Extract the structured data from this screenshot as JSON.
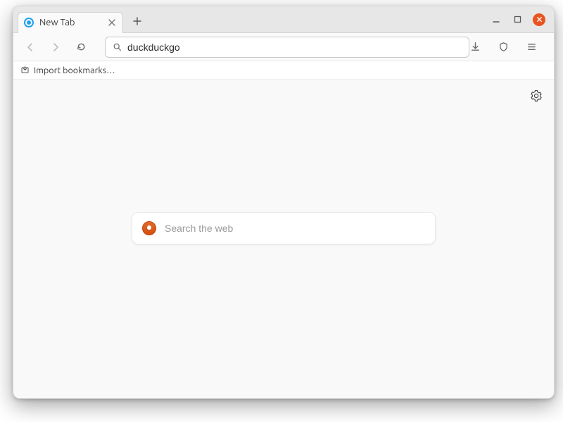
{
  "tab": {
    "title": "New Tab"
  },
  "urlbar": {
    "value": "duckduckgo"
  },
  "bookmarks": {
    "import_label": "Import bookmarks…"
  },
  "content": {
    "search_placeholder": "Search the web"
  }
}
